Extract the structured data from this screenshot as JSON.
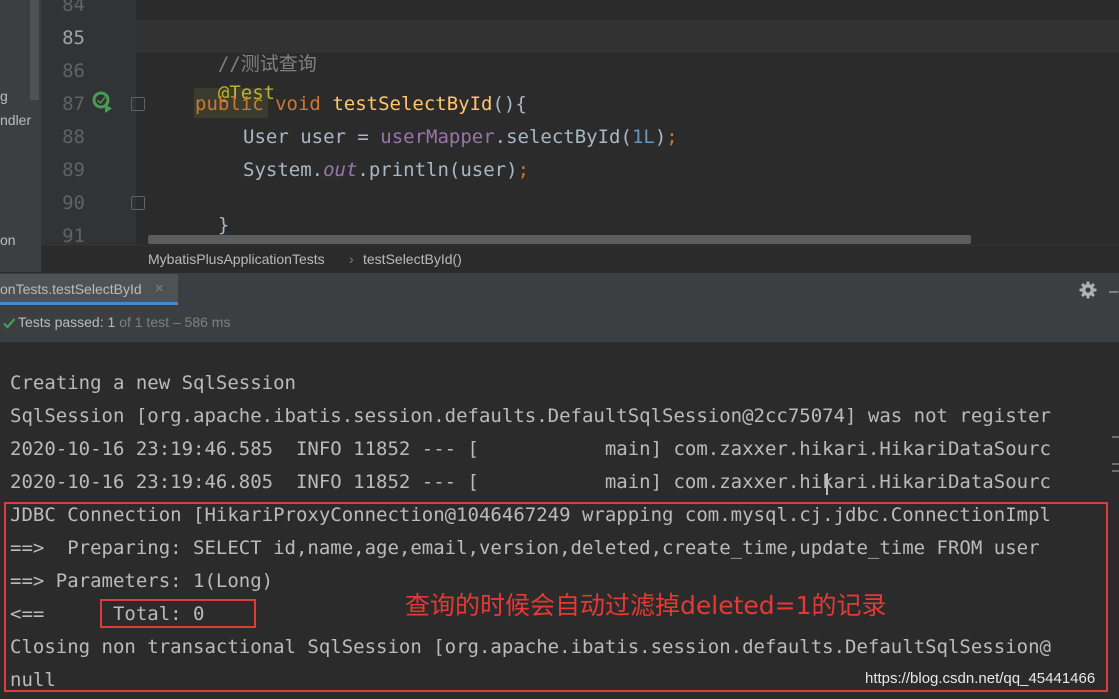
{
  "left_panel": {
    "labels": [
      "g",
      "ndler",
      "on"
    ]
  },
  "editor": {
    "line_numbers": [
      "84",
      "85",
      "86",
      "87",
      "88",
      "89",
      "90",
      "91"
    ],
    "code": {
      "comment": "//测试查询",
      "annotation": "@Test",
      "kw_public": "public",
      "kw_void": "void",
      "method_name": "testSelectById",
      "method_tail": "(){",
      "line88_type": "User user = ",
      "line88_field": "userMapper",
      "line88_call": ".selectById(",
      "line88_num": "1L",
      "line88_end": ")",
      "line88_semi": ";",
      "line89_a": "System.",
      "line89_out": "out",
      "line89_b": ".println(user)",
      "line89_semi": ";",
      "line90": "}"
    }
  },
  "breadcrumb": {
    "items": [
      "MybatisPlusApplicationTests",
      "testSelectById()"
    ],
    "separator": "›"
  },
  "run_window": {
    "tab_label": "onTests.testSelectById",
    "tab_close": "×",
    "status_prefix": "Tests passed:",
    "status_count": "1",
    "status_suffix": "of 1 test – 586 ms"
  },
  "console": {
    "lines": [
      "Creating a new SqlSession",
      "SqlSession [org.apache.ibatis.session.defaults.DefaultSqlSession@2cc75074] was not register",
      "2020-10-16 23:19:46.585  INFO 11852 --- [           main] com.zaxxer.hikari.HikariDataSourc",
      "2020-10-16 23:19:46.805  INFO 11852 --- [           main] com.zaxxer.hikari.HikariDataSourc",
      "JDBC Connection [HikariProxyConnection@1046467249 wrapping com.mysql.cj.jdbc.ConnectionImpl",
      "==>  Preparing: SELECT id,name,age,email,version,deleted,create_time,update_time FROM user",
      "==> Parameters: 1(Long)",
      "<==      Total: 0",
      "Closing non transactional SqlSession [org.apache.ibatis.session.defaults.DefaultSqlSession@",
      "null"
    ]
  },
  "annotation_text": "查询的时候会自动过滤掉deleted=1的记录",
  "watermark": "https://blog.csdn.net/qq_45441466",
  "colors": {
    "editor_bg": "#2b2b2b",
    "keyword": "#cc7832",
    "function": "#ffc66d",
    "field": "#9876aa",
    "number": "#6897bb",
    "annotation": "#bbb529",
    "comment": "#808080",
    "highlight_red": "#e03a3a",
    "pass_green": "#499c54"
  }
}
